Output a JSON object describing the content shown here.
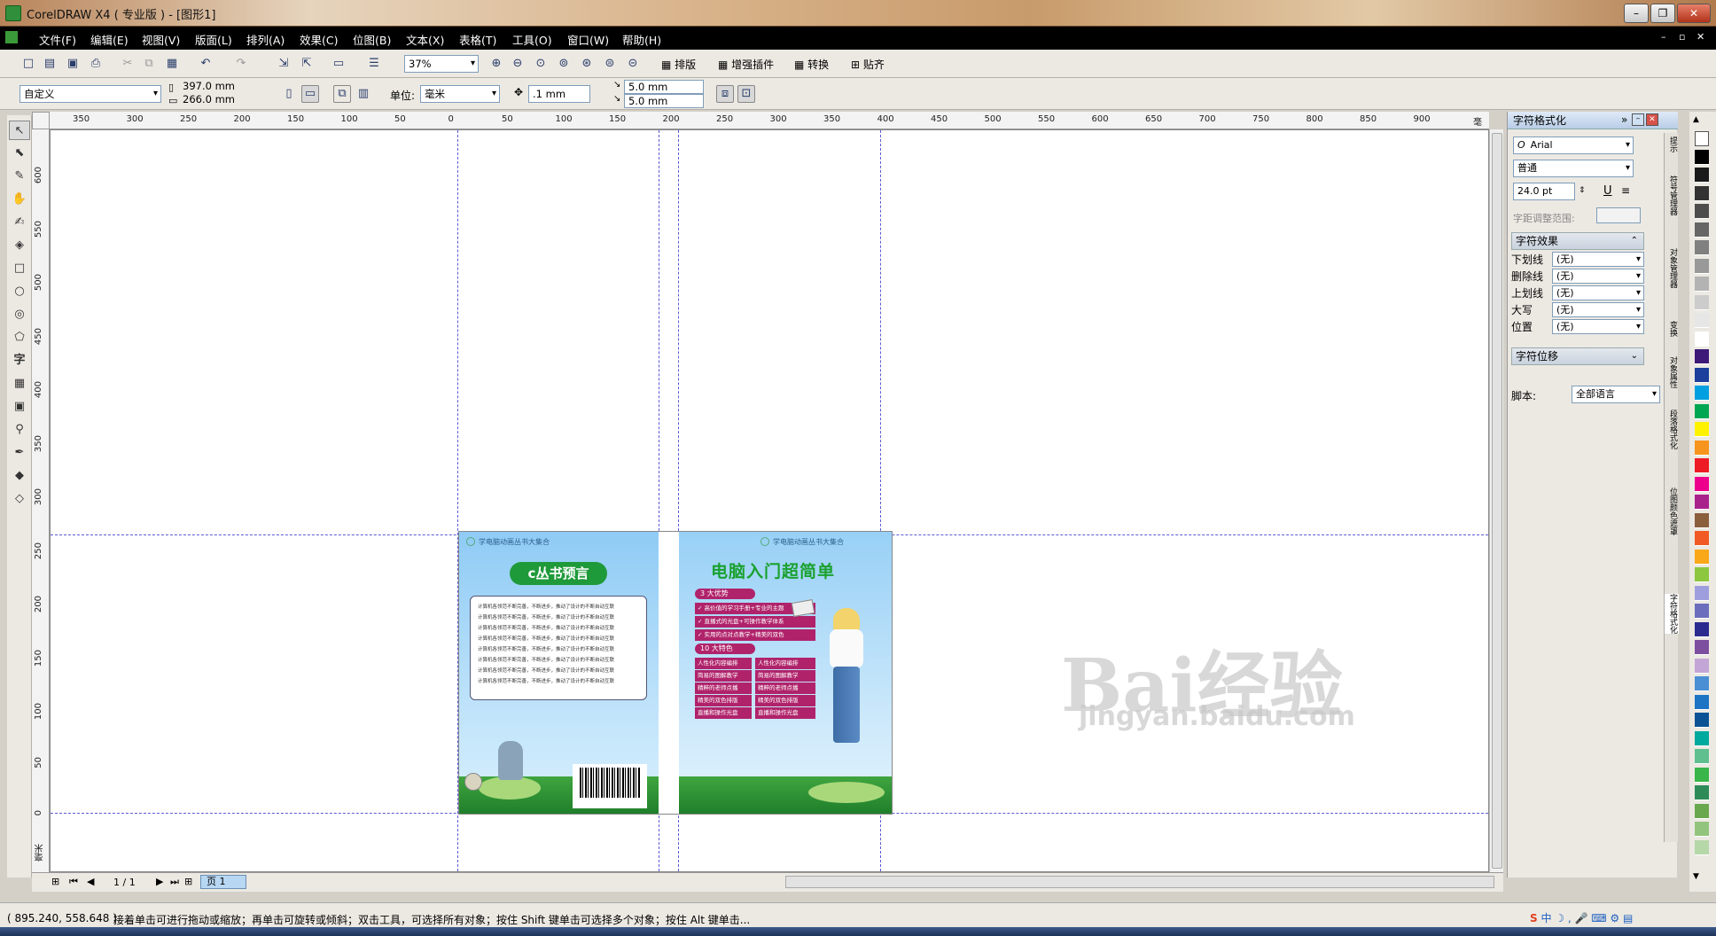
{
  "window": {
    "title": "CorelDRAW X4 ( 专业版 ) - [图形1]"
  },
  "menu": [
    "文件(F)",
    "编辑(E)",
    "视图(V)",
    "版面(L)",
    "排列(A)",
    "效果(C)",
    "位图(B)",
    "文本(X)",
    "表格(T)",
    "工具(O)",
    "窗口(W)",
    "帮助(H)"
  ],
  "toolbar": {
    "zoom": "37%",
    "btn_paiban": "排版",
    "btn_plugins": "增强插件",
    "btn_convert": "转换",
    "btn_snap": "贴齐"
  },
  "propbar": {
    "preset": "自定义",
    "width": "397.0 mm",
    "height": "266.0 mm",
    "unit_label": "单位:",
    "unit": "毫米",
    "nudge": ".1 mm",
    "dup_x": "5.0 mm",
    "dup_y": "5.0 mm"
  },
  "ruler_h": [
    "350",
    "300",
    "250",
    "200",
    "150",
    "100",
    "50",
    "0",
    "50",
    "100",
    "150",
    "200",
    "250",
    "300",
    "350",
    "400",
    "450",
    "500",
    "550",
    "600",
    "650",
    "700",
    "750",
    "800",
    "850",
    "900",
    "毫米"
  ],
  "ruler_v": [
    "600",
    "550",
    "500",
    "450",
    "400",
    "350",
    "300",
    "250",
    "200",
    "150",
    "100",
    "50",
    "0",
    "毫米"
  ],
  "page_nav": {
    "count": "1 / 1",
    "tab": "页 1"
  },
  "cover": {
    "series_left": "学电脑动画丛书大集合",
    "series_right": "学电脑动画丛书大集合",
    "left_title": "c丛书预言",
    "body_line": "计算机各领范不断完善，不断进步，推动了设计的不断自动互联",
    "right_title": "电脑入门超简单",
    "adv_header": "3 大优势",
    "advantages": [
      "高价值的学习手册+专业的主题",
      "直播式的光盘+可操作教学体系",
      "实用的点对点教学+精美的双色"
    ],
    "feat_header": "10 大特色",
    "features": [
      [
        "人性化内容编排",
        "人性化内容编排"
      ],
      [
        "简易的图解教学",
        "简易的图解教学"
      ],
      [
        "精粹的老师点播",
        "精粹的老师点播"
      ],
      [
        "精美的双色排版",
        "精美的双色排版"
      ],
      [
        "直播和操作光盘",
        "直播和操作光盘"
      ]
    ]
  },
  "docker": {
    "title": "字符格式化",
    "font": "Arial",
    "style": "普通",
    "size": "24.0 pt",
    "kerning_label": "字距调整范围:",
    "effects_header": "字符效果",
    "effects": [
      {
        "label": "下划线",
        "value": "(无)"
      },
      {
        "label": "删除线",
        "value": "(无)"
      },
      {
        "label": "上划线",
        "value": "(无)"
      },
      {
        "label": "大写",
        "value": "(无)"
      },
      {
        "label": "位置",
        "value": "(无)"
      }
    ],
    "shift_header": "字符位移",
    "script_label": "脚本:",
    "script_value": "全部语言",
    "side_tabs": [
      "提示",
      "符号管理器",
      "对象管理器",
      "变换",
      "对象属性",
      "段落格式化",
      "位图颜色遮罩",
      "字符格式化"
    ]
  },
  "palette_colors": [
    "#ffffff",
    "#000000",
    "#1a1a1a",
    "#333333",
    "#4d4d4d",
    "#666666",
    "#808080",
    "#999999",
    "#b3b3b3",
    "#cccccc",
    "#e6e6e6",
    "#ffffff",
    "#3d1a78",
    "#1b3f9a",
    "#00a0e0",
    "#00a651",
    "#fff200",
    "#f7941d",
    "#ed1c24",
    "#ec008c",
    "#a9228c",
    "#8b5e3c",
    "#f15a24",
    "#f9a81a",
    "#8dc63f",
    "#9e9ede",
    "#6d6dbd",
    "#2b2b8f",
    "#7d4ea0",
    "#c3a6d6",
    "#4a8fd4",
    "#1d74c4",
    "#0b5394",
    "#00a99d",
    "#5fbf8f",
    "#39b54a",
    "#2e8b57",
    "#6aa84f",
    "#93c47d",
    "#b6d7a8"
  ],
  "status": {
    "coords": "( 895.240, 558.648 )",
    "message": "接着单击可进行拖动或缩放；再单击可旋转或倾斜；双击工具，可选择所有对象；按住 Shift 键单击可选择多个对象；按住 Alt 键单击..."
  },
  "watermark": {
    "logo": "Bai经验",
    "url": "jingyan.baidu.com"
  }
}
